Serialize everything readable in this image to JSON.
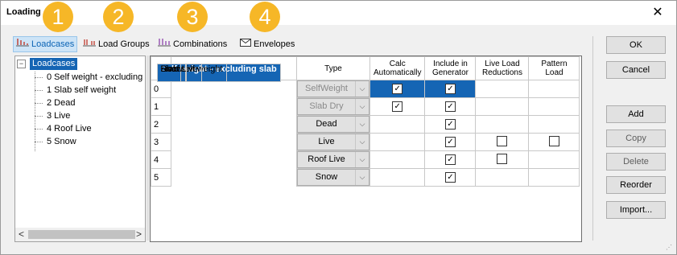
{
  "window": {
    "title": "Loading",
    "close_glyph": "✕"
  },
  "badges": [
    "1",
    "2",
    "3",
    "4"
  ],
  "badge_color": "#f6b727",
  "tabs": [
    {
      "label": "Loadcases",
      "icon": "loadcases-icon",
      "active": true
    },
    {
      "label": "Load Groups",
      "icon": "load-groups-icon",
      "active": false
    },
    {
      "label": "Combinations",
      "icon": "combinations-icon",
      "active": false
    },
    {
      "label": "Envelopes",
      "icon": "envelope-icon",
      "active": false
    }
  ],
  "tree": {
    "root": "Loadcases",
    "expander": "−",
    "items": [
      "0 Self weight - excluding",
      "1 Slab self weight",
      "2 Dead",
      "3 Live",
      "4 Roof Live",
      "5 Snow"
    ],
    "scroll_left": "<",
    "scroll_right": ">"
  },
  "grid": {
    "headers": [
      "#",
      "Loadcase Title",
      "Type",
      "Calc Automatically",
      "Include in Generator",
      "Live Load Reductions",
      "Pattern Load"
    ],
    "rows": [
      {
        "num": "0",
        "title": "Self weight - excluding slab",
        "type": "SelfWeight",
        "type_enabled": false,
        "calc_auto": true,
        "include": true,
        "llr": null,
        "pattern": null,
        "selected": true,
        "bold": true
      },
      {
        "num": "1",
        "title": "Slab self weight",
        "type": "Slab Dry",
        "type_enabled": false,
        "calc_auto": true,
        "include": true,
        "llr": null,
        "pattern": null,
        "selected": false,
        "bold": true
      },
      {
        "num": "2",
        "title": "Dead",
        "type": "Dead",
        "type_enabled": true,
        "calc_auto": null,
        "include": true,
        "llr": null,
        "pattern": null,
        "selected": false,
        "bold": false
      },
      {
        "num": "3",
        "title": "Live",
        "type": "Live",
        "type_enabled": true,
        "calc_auto": null,
        "include": true,
        "llr": false,
        "pattern": false,
        "selected": false,
        "bold": false
      },
      {
        "num": "4",
        "title": "Roof Live",
        "type": "Roof Live",
        "type_enabled": true,
        "calc_auto": null,
        "include": true,
        "llr": false,
        "pattern": null,
        "selected": false,
        "bold": false
      },
      {
        "num": "5",
        "title": "Snow",
        "type": "Snow",
        "type_enabled": true,
        "calc_auto": null,
        "include": true,
        "llr": null,
        "pattern": null,
        "selected": false,
        "bold": false
      }
    ],
    "dropdown_glyph": "⌵",
    "check_glyph": "✓"
  },
  "buttons": {
    "ok": "OK",
    "cancel": "Cancel",
    "add": "Add",
    "copy": "Copy",
    "delete": "Delete",
    "reorder": "Reorder",
    "import": "Import..."
  },
  "colors": {
    "selection": "#1565b4",
    "accent_link": "#0a63b5"
  }
}
